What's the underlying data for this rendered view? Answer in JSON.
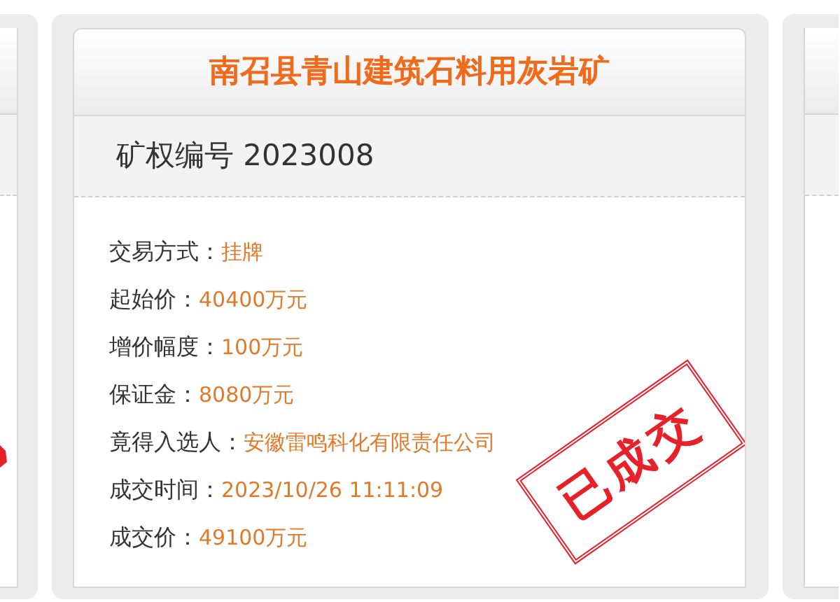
{
  "card": {
    "title": "南召县青山建筑石料用灰岩矿",
    "subtitle": "矿权编号 2023008",
    "fields": [
      {
        "label": "交易方式：",
        "value": "挂牌"
      },
      {
        "label": "起始价：",
        "value": "40400万元"
      },
      {
        "label": "增价幅度：",
        "value": "100万元"
      },
      {
        "label": "保证金：",
        "value": "8080万元"
      },
      {
        "label": "竟得入选人：",
        "value": "安徽雷鸣科化有限责任公司"
      },
      {
        "label": "成交时间：",
        "value": "2023/10/26 11:11:09"
      },
      {
        "label": "成交价：",
        "value": "49100万元"
      }
    ],
    "stamp": {
      "text": "已成交"
    }
  }
}
